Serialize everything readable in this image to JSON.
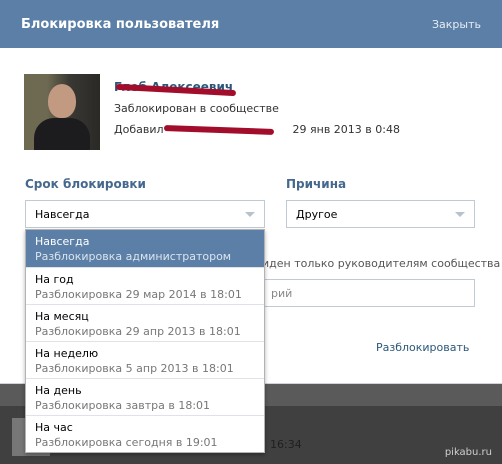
{
  "modal": {
    "title": "Блокировка пользователя",
    "close_label": "Закрыть"
  },
  "profile": {
    "name": "Глеб Алексеевич",
    "status": "Заблокирован в сообществе",
    "added_prefix": "Добавил",
    "added_date": "29 янв 2013 в 0:48"
  },
  "term": {
    "label": "Срок блокировки",
    "selected": "Навсегда",
    "options": [
      {
        "title": "Навсегда",
        "sub": "Разблокировка администратором"
      },
      {
        "title": "На год",
        "sub": "Разблокировка 29 мар 2014 в 18:01"
      },
      {
        "title": "На месяц",
        "sub": "Разблокировка 29 апр 2013 в 18:01"
      },
      {
        "title": "На неделю",
        "sub": "Разблокировка 5 апр 2013 в 18:01"
      },
      {
        "title": "На день",
        "sub": "Разблокировка завтра в 18:01"
      },
      {
        "title": "На час",
        "sub": "Разблокировка сегодня в 19:01"
      }
    ]
  },
  "reason": {
    "label": "Причина",
    "selected": "Другое"
  },
  "comment": {
    "hint": "иден только руководителям сообщества",
    "placeholder": "рий"
  },
  "unblock_label": "Разблокировать",
  "background": {
    "time": "16:34",
    "watermark": "pikabu.ru"
  },
  "colors": {
    "header": "#5b7fa6",
    "link": "#2b587a",
    "label": "#45688e",
    "selected_option": "#5b7fa6"
  }
}
